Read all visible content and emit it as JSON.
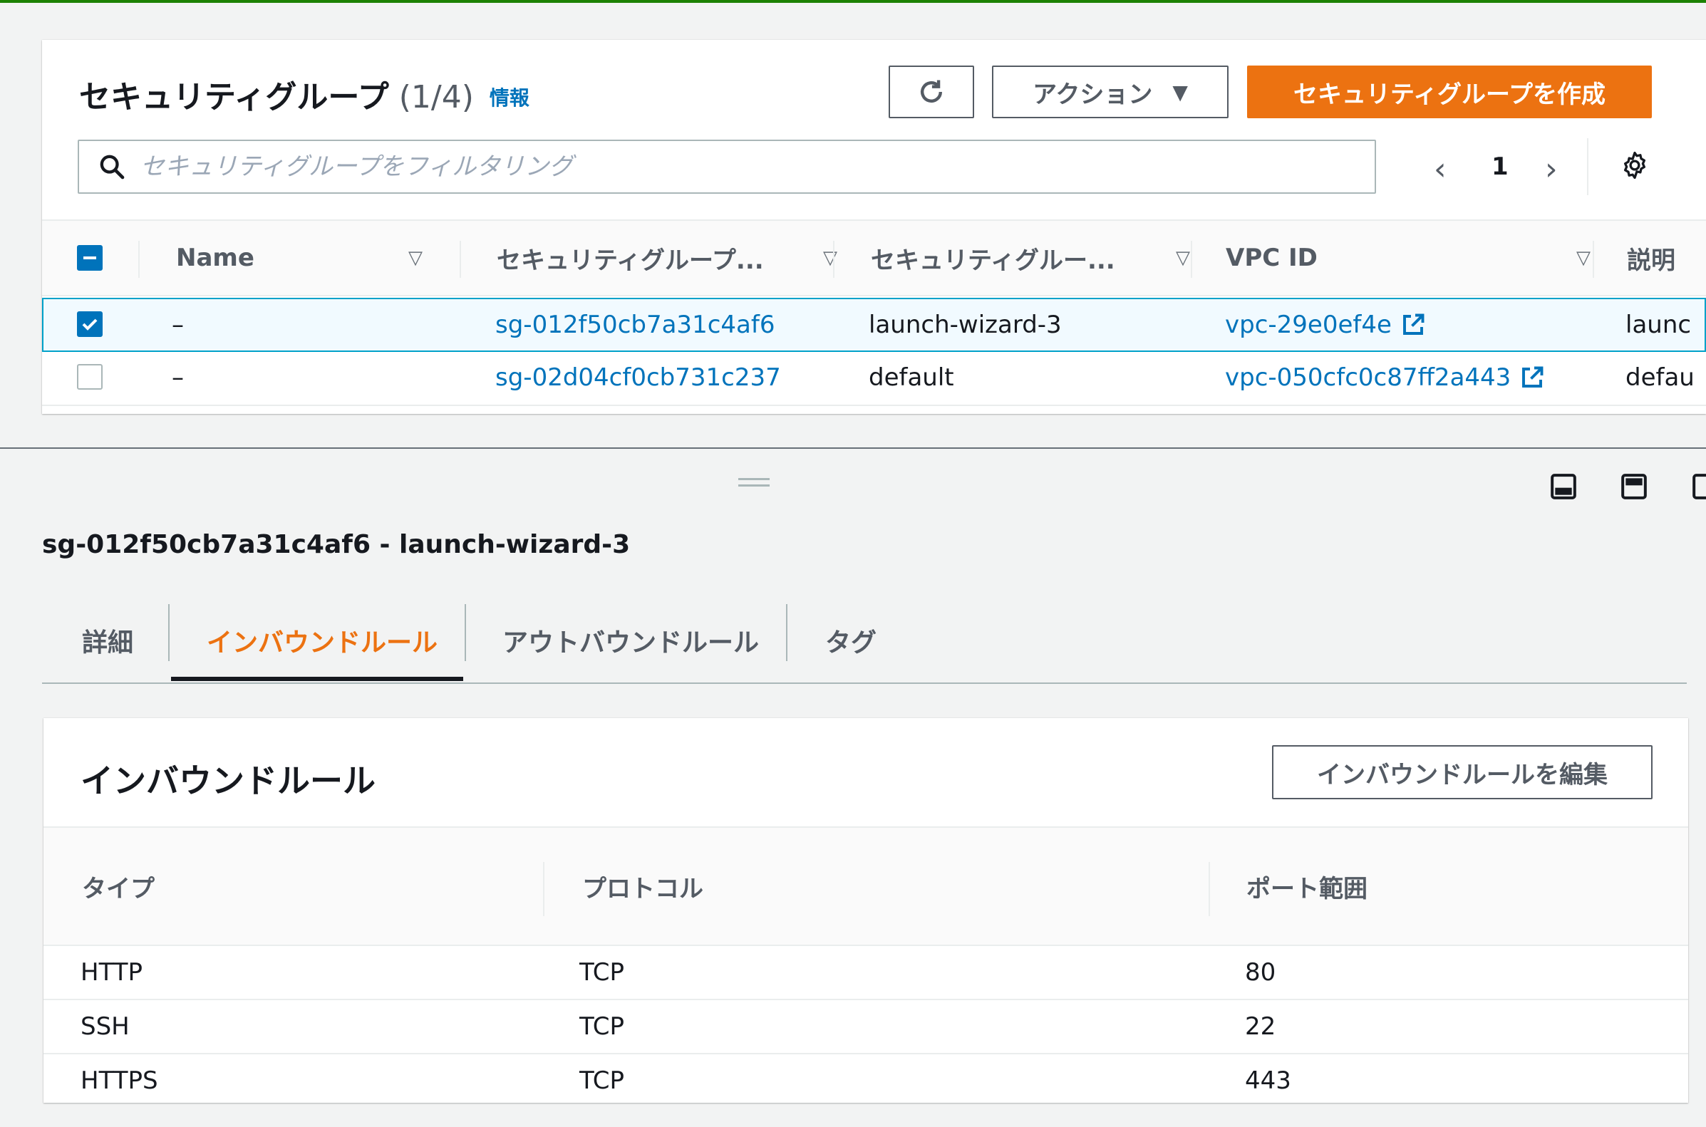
{
  "sg_list": {
    "title": "セキュリティグループ",
    "count": "(1/4)",
    "info_link": "情報",
    "actions_label": "アクション",
    "create_label": "セキュリティグループを作成",
    "search_placeholder": "セキュリティグループをフィルタリング",
    "page_number": "1",
    "columns": [
      "Name",
      "セキュリティグループ...",
      "セキュリティグルー...",
      "VPC ID",
      "説明"
    ],
    "rows": [
      {
        "selected": true,
        "name": "–",
        "sg_id": "sg-012f50cb7a31c4af6",
        "sg_name": "launch-wizard-3",
        "vpc_id": "vpc-29e0ef4e",
        "description": "launc"
      },
      {
        "selected": false,
        "name": "–",
        "sg_id": "sg-02d04cf0cb731c237",
        "sg_name": "default",
        "vpc_id": "vpc-050cfc0c87ff2a443",
        "description": "defau"
      }
    ]
  },
  "detail": {
    "title": "sg-012f50cb7a31c4af6 - launch-wizard-3",
    "tabs": [
      {
        "label": "詳細",
        "active": false
      },
      {
        "label": "インバウンドルール",
        "active": true
      },
      {
        "label": "アウトバウンドルール",
        "active": false
      },
      {
        "label": "タグ",
        "active": false
      }
    ]
  },
  "inbound_rules": {
    "title": "インバウンドルール",
    "edit_label": "インバウンドルールを編集",
    "columns": [
      "タイプ",
      "プロトコル",
      "ポート範囲"
    ],
    "rows": [
      {
        "type": "HTTP",
        "protocol": "TCP",
        "port_range": "80"
      },
      {
        "type": "SSH",
        "protocol": "TCP",
        "port_range": "22"
      },
      {
        "type": "HTTPS",
        "protocol": "TCP",
        "port_range": "443"
      }
    ]
  },
  "colors": {
    "primary_orange": "#ec7211",
    "link_blue": "#0073bb",
    "selected_border": "#00a1c9",
    "top_bar_green": "#1d8102"
  },
  "icons": [
    "refresh-icon",
    "caret-down-icon",
    "search-icon",
    "chevron-left-icon",
    "chevron-right-icon",
    "gear-icon",
    "sort-icon",
    "external-link-icon",
    "drag-handle-icon",
    "layout-bottom-icon",
    "layout-side-icon"
  ]
}
